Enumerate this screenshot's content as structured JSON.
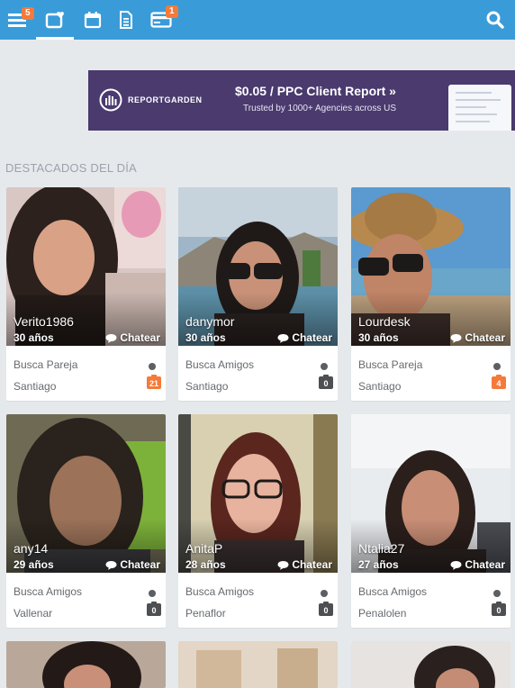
{
  "topbar": {
    "menu_badge": "5",
    "card_badge": "1",
    "icons": [
      "menu-icon",
      "matches-icon",
      "calendar-icon",
      "document-icon",
      "credit-card-icon",
      "search-icon"
    ],
    "bg_color": "#3a9bd9",
    "badge_color": "#f47a3a"
  },
  "ad": {
    "logo_text": "REPORTGARDEN",
    "title": "$0.05 / PPC Client Report »",
    "subtitle": "Trusted by 1000+ Agencies across US",
    "bg_color": "#4a3a6e"
  },
  "section_title": "DESTACADOS DEL DÍA",
  "chat_label": "Chatear",
  "profiles": [
    {
      "name": "Verito1986",
      "age": "30 años",
      "seeking": "Busca Pareja",
      "city": "Santiago",
      "photos": "21",
      "photo_badge_color": "#f47a3a"
    },
    {
      "name": "danymor",
      "age": "30 años",
      "seeking": "Busca Amigos",
      "city": "Santiago",
      "photos": "0",
      "photo_badge_color": "#4d4f52"
    },
    {
      "name": "Lourdesk",
      "age": "30 años",
      "seeking": "Busca Pareja",
      "city": "Santiago",
      "photos": "4",
      "photo_badge_color": "#f47a3a"
    },
    {
      "name": "any14",
      "age": "29 años",
      "seeking": "Busca Amigos",
      "city": "Vallenar",
      "photos": "0",
      "photo_badge_color": "#4d4f52"
    },
    {
      "name": "AnitaP",
      "age": "28 años",
      "seeking": "Busca Amigos",
      "city": "Penaflor",
      "photos": "0",
      "photo_badge_color": "#4d4f52"
    },
    {
      "name": "Ntalia27",
      "age": "27 años",
      "seeking": "Busca Amigos",
      "city": "Penalolen",
      "photos": "0",
      "photo_badge_color": "#4d4f52"
    }
  ]
}
